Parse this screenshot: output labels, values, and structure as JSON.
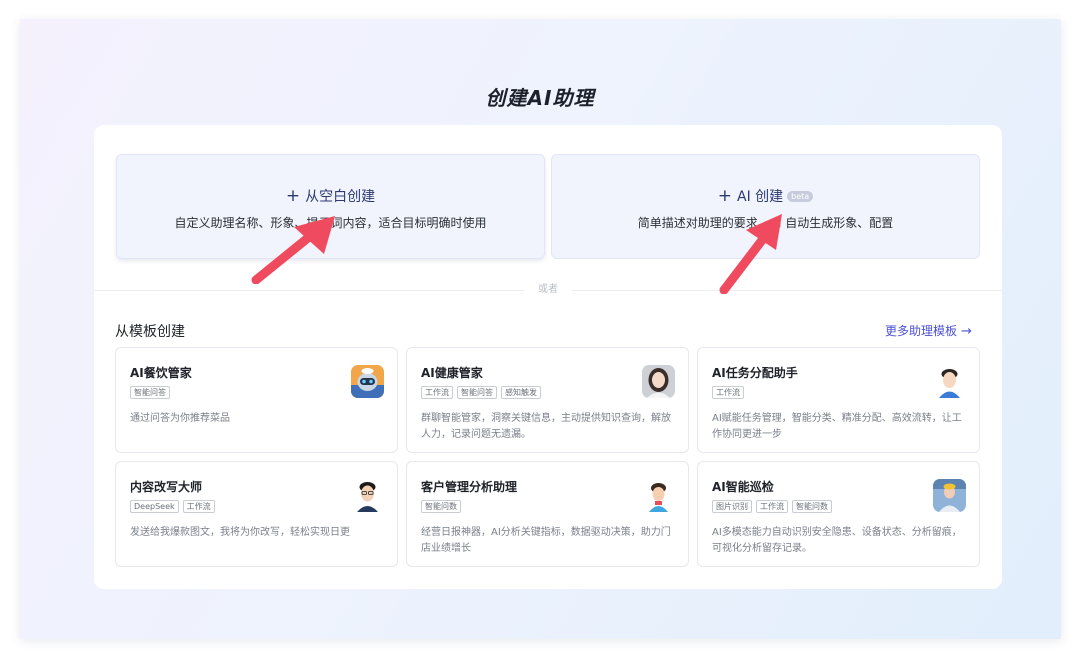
{
  "page_title": "创建AI助理",
  "blank_create": {
    "plus_icon": "+",
    "label": "从空白创建",
    "description": "自定义助理名称、形象、提示词内容，适合目标明确时使用"
  },
  "ai_create": {
    "plus_icon": "+",
    "label": "AI 创建",
    "badge": "beta",
    "description": "简单描述对助理的要求，AI 自动生成形象、配置"
  },
  "divider_text": "或者",
  "templates_section": {
    "title": "从模板创建",
    "more_link": "更多助理模板",
    "more_arrow": "→",
    "cards": [
      {
        "name": "AI餐饮管家",
        "tags": [
          "智能问答"
        ],
        "description": "通过问答为你推荐菜品",
        "avatar_icon": "robot-chef-avatar"
      },
      {
        "name": "AI健康管家",
        "tags": [
          "工作流",
          "智能问答",
          "感知触发"
        ],
        "description": "群聊智能管家，洞察关键信息，主动提供知识查询，解放人力，记录问题无遗漏。",
        "avatar_icon": "woman-portrait-avatar"
      },
      {
        "name": "AI任务分配助手",
        "tags": [
          "工作流"
        ],
        "description": "AI赋能任务管理，智能分类、精准分配、高效流转，让工作协同更进一步",
        "avatar_icon": "smiling-man-avatar"
      },
      {
        "name": "内容改写大师",
        "tags": [
          "DeepSeek",
          "工作流"
        ],
        "description": "发送给我爆款图文，我将为你改写，轻松实现日更",
        "avatar_icon": "man-glasses-avatar"
      },
      {
        "name": "客户管理分析助理",
        "tags": [
          "智能问数"
        ],
        "description": "经营日报神器，AI分析关键指标，数据驱动决策，助力门店业绩增长",
        "avatar_icon": "cartoon-man-avatar"
      },
      {
        "name": "AI智能巡检",
        "tags": [
          "图片识别",
          "工作流",
          "智能问数"
        ],
        "description": "AI多模态能力自动识别安全隐患、设备状态、分析留痕，可视化分析留存记录。",
        "avatar_icon": "inspector-avatar"
      }
    ]
  },
  "colors": {
    "accent": "#4d50d2",
    "annotation_arrow": "#f04a5e",
    "card_bg": "#f1f4fd"
  }
}
